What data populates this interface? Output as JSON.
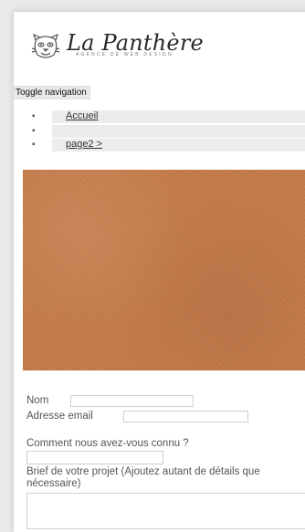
{
  "brand": {
    "title": "La Panthère",
    "subtitle": "AGENCE DE WEB DESIGN"
  },
  "toggle_label": "Toggle navigation",
  "nav": {
    "items": [
      {
        "label": "Accueil"
      },
      {
        "label": ""
      },
      {
        "label": "page2 >"
      }
    ]
  },
  "form": {
    "nom_label": "Nom",
    "email_label": "Adresse email",
    "connu_label": "Comment nous avez-vous connu ?",
    "brief_label": "Brief de votre projet (Ajoutez autant de détails que nécessaire)"
  },
  "colors": {
    "hero": "#c47a4a"
  }
}
